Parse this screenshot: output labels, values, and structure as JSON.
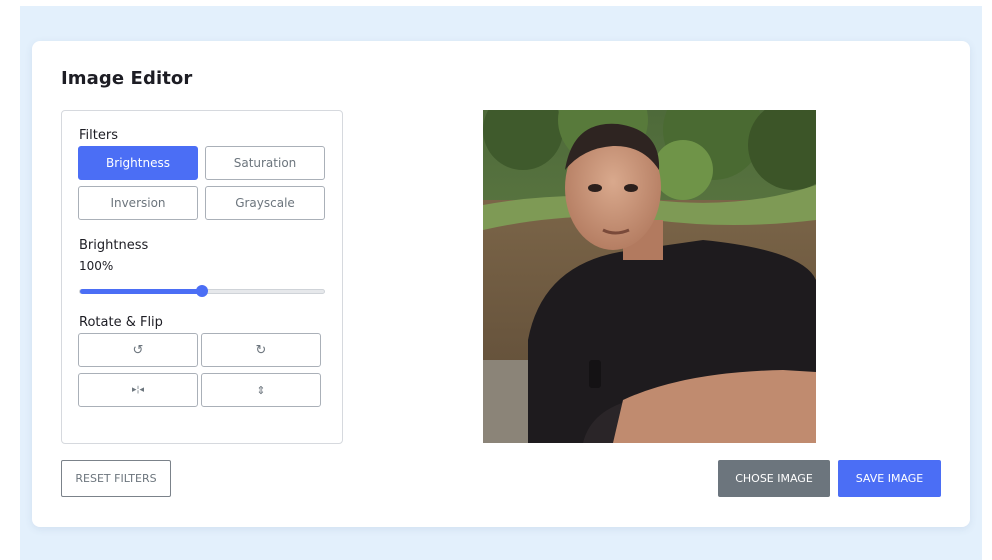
{
  "editor": {
    "title": "Image Editor",
    "filters_label": "Filters",
    "filters": [
      {
        "label": "Brightness",
        "active": true
      },
      {
        "label": "Saturation",
        "active": false
      },
      {
        "label": "Inversion",
        "active": false
      },
      {
        "label": "Grayscale",
        "active": false
      }
    ],
    "active_filter": {
      "name": "Brightness",
      "value_text": "100%",
      "slider_fraction": 0.5
    },
    "rotate_flip_label": "Rotate & Flip",
    "rotate_flip_buttons": [
      {
        "icon": "rotate-left-icon",
        "glyph": "↺"
      },
      {
        "icon": "rotate-right-icon",
        "glyph": "↻"
      },
      {
        "icon": "flip-horizontal-icon",
        "glyph": "▸¦◂"
      },
      {
        "icon": "flip-vertical-icon",
        "glyph": "⇕"
      }
    ],
    "actions": {
      "reset": "RESET FILTERS",
      "chose": "CHOSE IMAGE",
      "save": "SAVE IMAGE"
    },
    "colors": {
      "accent": "#4b6ef5",
      "secondary": "#6c757d",
      "page_background": "#e3f0fc"
    }
  }
}
